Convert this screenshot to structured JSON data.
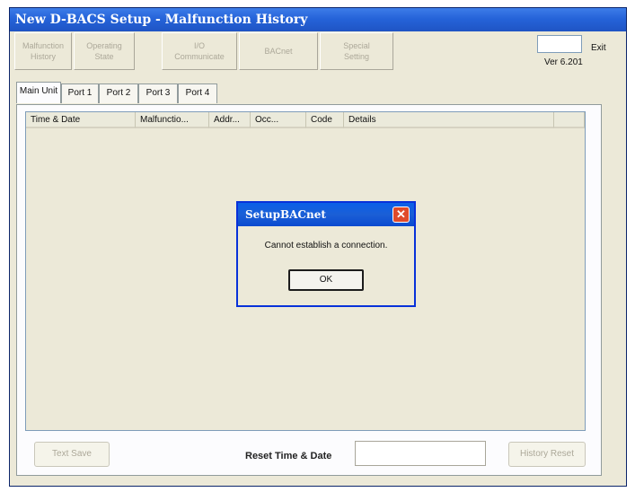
{
  "window": {
    "title": "New D-BACS Setup - Malfunction History"
  },
  "toolbar": {
    "buttons": [
      {
        "label": "Malfunction\nHistory"
      },
      {
        "label": "Operating\nState"
      },
      {
        "label": "I/O\nCommunicate"
      },
      {
        "label": "BACnet"
      },
      {
        "label": "Special\nSetting"
      }
    ],
    "version": "Ver 6.201",
    "exit_label": "Exit"
  },
  "tabs": [
    "Main Unit",
    "Port 1",
    "Port 2",
    "Port 3",
    "Port 4"
  ],
  "table": {
    "columns": [
      "Time & Date",
      "Malfunctio...",
      "Addr...",
      "Occ...",
      "Code",
      "Details"
    ],
    "rows": []
  },
  "bottom": {
    "text_save_label": "Text Save",
    "reset_label": "Reset Time & Date",
    "reset_value": "",
    "history_reset_label": "History Reset"
  },
  "dialog": {
    "title": "SetupBACnet",
    "message": "Cannot establish a connection.",
    "ok_label": "OK",
    "close_glyph": "✕"
  }
}
